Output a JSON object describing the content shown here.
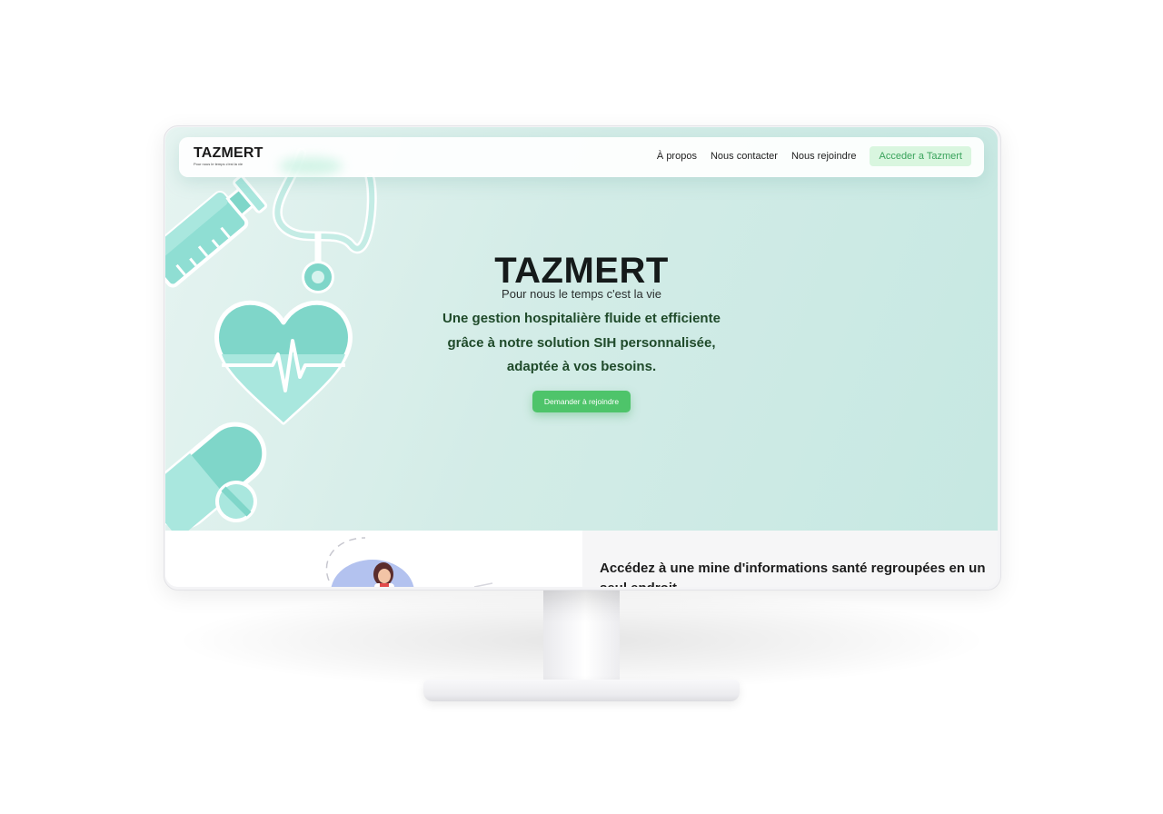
{
  "navbar": {
    "brand_name": "TAZMERT",
    "brand_tagline": "Pour nous le temps c'est la vie",
    "links": [
      "À propos",
      "Nous contacter",
      "Nous rejoindre"
    ],
    "cta_label": "Acceder a Tazmert"
  },
  "hero": {
    "title": "TAZMERT",
    "subtitle": "Pour nous le temps c'est la vie",
    "description_lines": [
      "Une gestion hospitalière fluide et efficiente",
      "grâce à notre solution SIH personnalisée,",
      "adaptée à vos besoins."
    ],
    "cta_label": "Demander à rejoindre"
  },
  "section": {
    "heading": "Accédez à une mine d'informations santé regroupées en un seul endroit"
  },
  "icons": [
    "syringe-icon",
    "stethoscope-icon",
    "heart-ecg-icon",
    "pill-capsule-icon",
    "tablet-pill-icon",
    "doctor-illustration"
  ],
  "colors": {
    "accent_green": "#4ec46a",
    "cta_soft_bg": "#d9f6df",
    "cta_soft_text": "#3aa35c",
    "teal": "#6fd1c2",
    "hero_bg": "#d3ece7",
    "heading_green": "#1f4a2a"
  }
}
